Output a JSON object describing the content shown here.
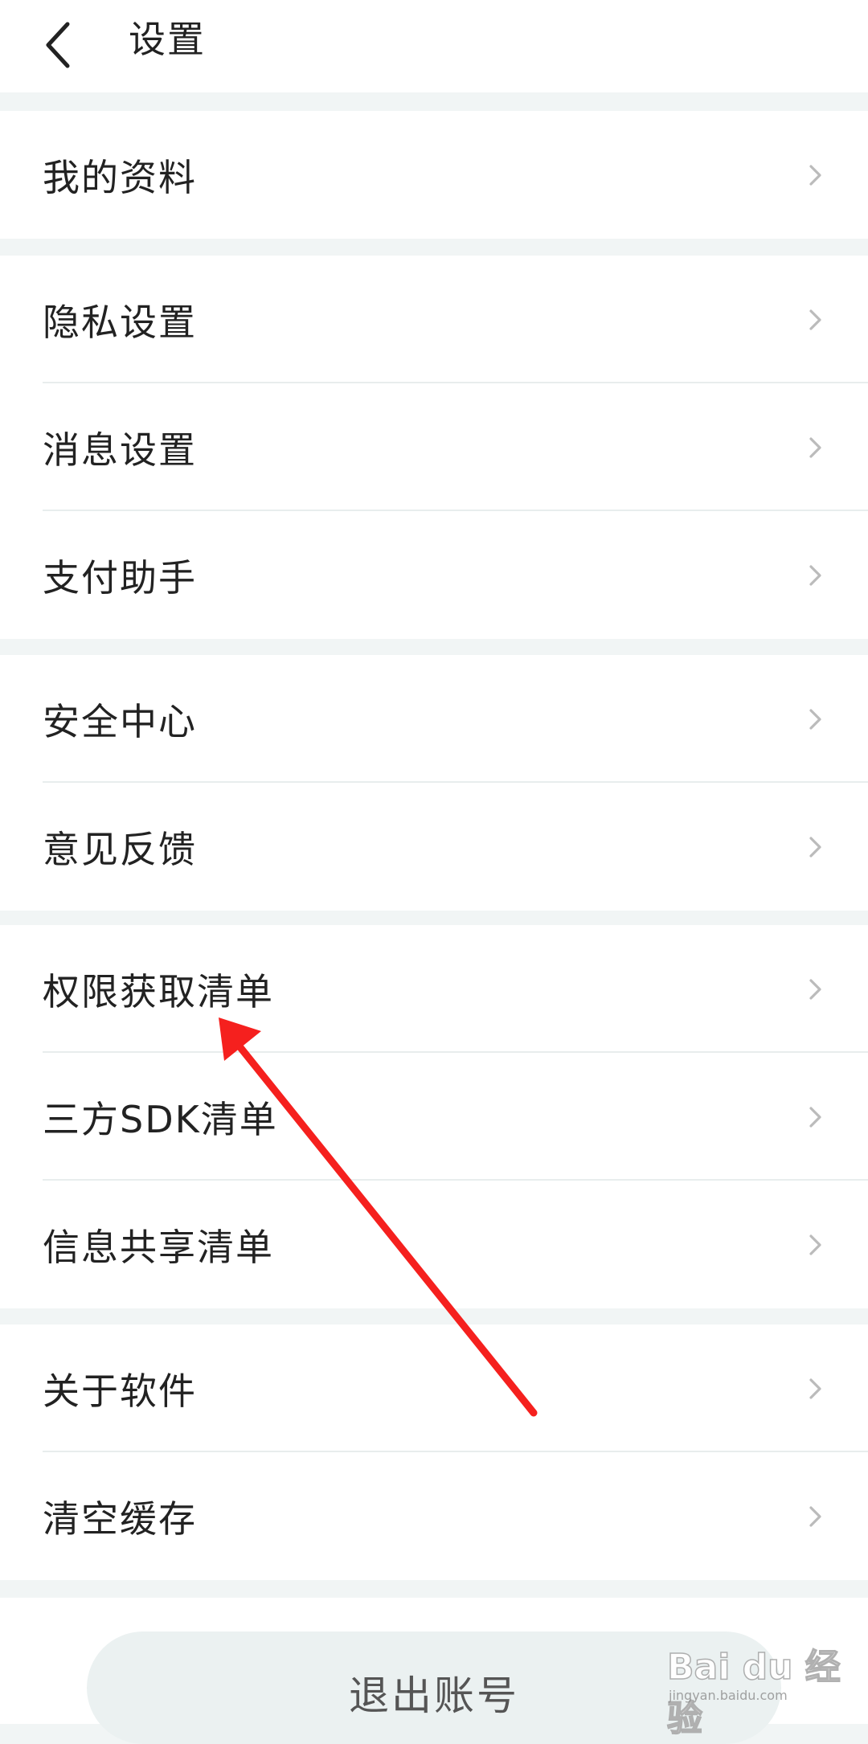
{
  "header": {
    "title": "设置"
  },
  "groups": [
    {
      "items": [
        {
          "label": "我的资料"
        }
      ]
    },
    {
      "items": [
        {
          "label": "隐私设置"
        },
        {
          "label": "消息设置"
        },
        {
          "label": "支付助手"
        }
      ]
    },
    {
      "items": [
        {
          "label": "安全中心"
        },
        {
          "label": "意见反馈"
        }
      ]
    },
    {
      "items": [
        {
          "label": "权限获取清单"
        },
        {
          "label": "三方SDK清单"
        },
        {
          "label": "信息共享清单"
        }
      ]
    },
    {
      "items": [
        {
          "label": "关于软件"
        },
        {
          "label": "清空缓存"
        }
      ]
    }
  ],
  "logout": {
    "label": "退出账号"
  },
  "watermark": {
    "logo": "Bai du 经验",
    "url": "jingyan.baidu.com"
  },
  "colors": {
    "page_background": "#f1f5f5",
    "card_background": "#ffffff",
    "text": "#222222",
    "chevron": "#bbbbbb",
    "annotation_arrow": "#f5201e"
  }
}
